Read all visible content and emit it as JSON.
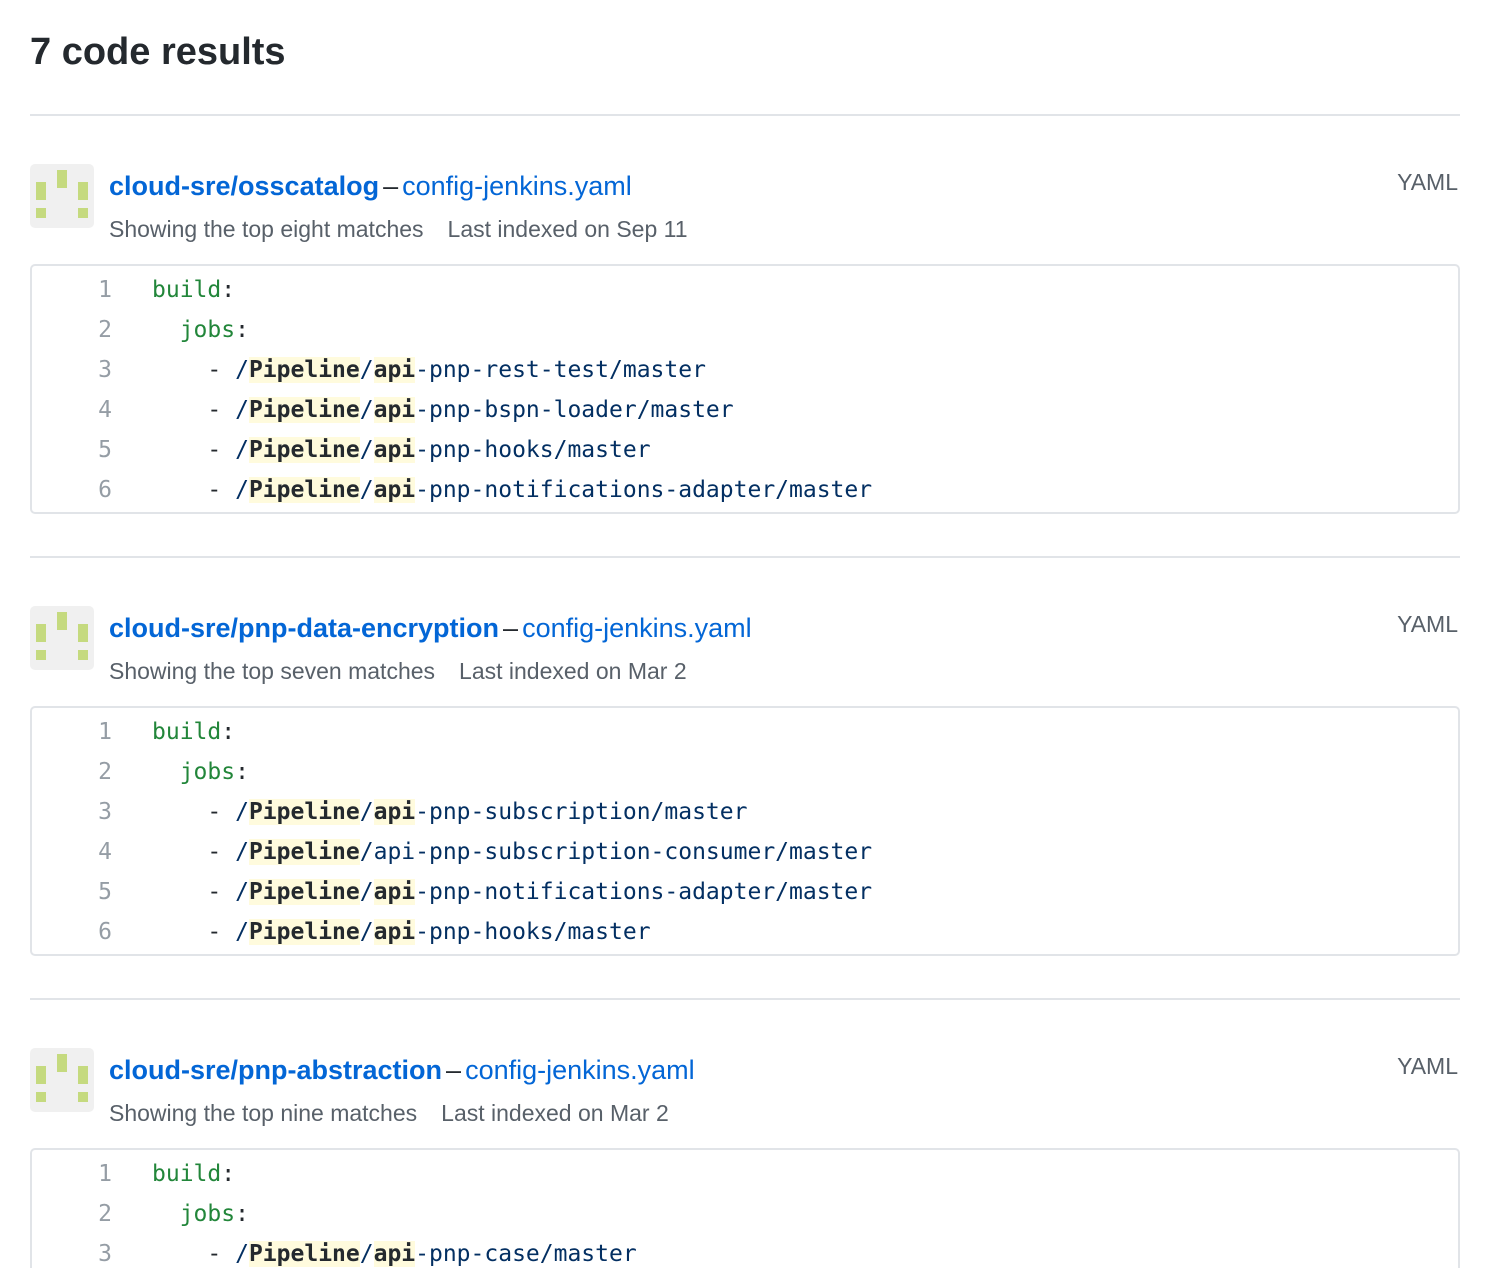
{
  "heading": "7 code results",
  "results": [
    {
      "repo": "cloud-sre/osscatalog",
      "separator": "–",
      "file": "config-jenkins.yaml",
      "language": "YAML",
      "matches_text": "Showing the top eight matches",
      "indexed_text": "Last indexed on Sep 11",
      "lines": [
        {
          "num": "1",
          "indent": "",
          "key": "build",
          "colon": ":"
        },
        {
          "num": "2",
          "indent": "  ",
          "key": "jobs",
          "colon": ":"
        },
        {
          "num": "3",
          "dash": "    - ",
          "slash1": "/",
          "hl1": "Pipeline",
          "slash2": "/",
          "hl2": "api",
          "rest": "-pnp-rest-test/master"
        },
        {
          "num": "4",
          "dash": "    - ",
          "slash1": "/",
          "hl1": "Pipeline",
          "slash2": "/",
          "hl2": "api",
          "rest": "-pnp-bspn-loader/master"
        },
        {
          "num": "5",
          "dash": "    - ",
          "slash1": "/",
          "hl1": "Pipeline",
          "slash2": "/",
          "hl2": "api",
          "rest": "-pnp-hooks/master"
        },
        {
          "num": "6",
          "dash": "    - ",
          "slash1": "/",
          "hl1": "Pipeline",
          "slash2": "/",
          "hl2": "api",
          "rest": "-pnp-notifications-adapter/master"
        }
      ]
    },
    {
      "repo": "cloud-sre/pnp-data-encryption",
      "separator": "–",
      "file": "config-jenkins.yaml",
      "language": "YAML",
      "matches_text": "Showing the top seven matches",
      "indexed_text": "Last indexed on Mar 2",
      "lines": [
        {
          "num": "1",
          "indent": "",
          "key": "build",
          "colon": ":"
        },
        {
          "num": "2",
          "indent": "  ",
          "key": "jobs",
          "colon": ":"
        },
        {
          "num": "3",
          "dash": "    - ",
          "slash1": "/",
          "hl1": "Pipeline",
          "slash2": "/",
          "hl2": "api",
          "rest": "-pnp-subscription/master"
        },
        {
          "num": "4",
          "dash": "    - ",
          "slash1": "/",
          "hl1": "Pipeline",
          "slash2": "/",
          "hl2": "",
          "rest": "api-pnp-subscription-consumer/master"
        },
        {
          "num": "5",
          "dash": "    - ",
          "slash1": "/",
          "hl1": "Pipeline",
          "slash2": "/",
          "hl2": "api",
          "rest": "-pnp-notifications-adapter/master"
        },
        {
          "num": "6",
          "dash": "    - ",
          "slash1": "/",
          "hl1": "Pipeline",
          "slash2": "/",
          "hl2": "api",
          "rest": "-pnp-hooks/master"
        }
      ]
    },
    {
      "repo": "cloud-sre/pnp-abstraction",
      "separator": "–",
      "file": "config-jenkins.yaml",
      "language": "YAML",
      "matches_text": "Showing the top nine matches",
      "indexed_text": "Last indexed on Mar 2",
      "lines": [
        {
          "num": "1",
          "indent": "",
          "key": "build",
          "colon": ":"
        },
        {
          "num": "2",
          "indent": "  ",
          "key": "jobs",
          "colon": ":"
        },
        {
          "num": "3",
          "dash": "    - ",
          "slash1": "/",
          "hl1": "Pipeline",
          "slash2": "/",
          "hl2": "api",
          "rest": "-pnp-case/master"
        }
      ]
    }
  ],
  "colors": {
    "link": "#0366d6",
    "highlight": "#fffbdd",
    "yaml_key": "#22863a",
    "identicon": "#c5da7f"
  },
  "icons": {
    "avatar": "identicon"
  }
}
